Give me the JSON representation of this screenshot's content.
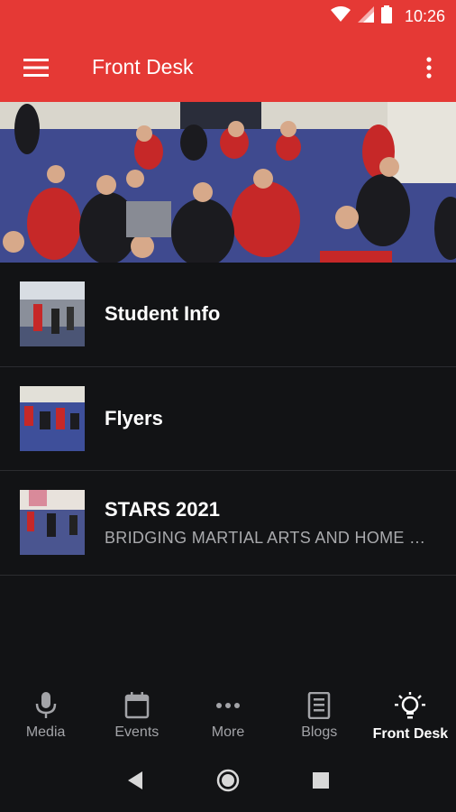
{
  "status_bar": {
    "time": "10:26"
  },
  "app_bar": {
    "title": "Front Desk"
  },
  "list": [
    {
      "title": "Student Info",
      "subtitle": ""
    },
    {
      "title": "Flyers",
      "subtitle": ""
    },
    {
      "title": "STARS 2021",
      "subtitle": "BRIDGING MARTIAL ARTS AND HOME W..."
    }
  ],
  "bottom_nav": [
    {
      "label": "Media",
      "icon": "microphone-icon"
    },
    {
      "label": "Events",
      "icon": "calendar-icon"
    },
    {
      "label": "More",
      "icon": "more-dots-icon"
    },
    {
      "label": "Blogs",
      "icon": "newspaper-icon"
    },
    {
      "label": "Front Desk",
      "icon": "lightbulb-icon",
      "active": true
    }
  ],
  "colors": {
    "primary": "#e53935",
    "background": "#121315",
    "divider": "#2b2c30",
    "inactive": "#a3a4a8"
  }
}
